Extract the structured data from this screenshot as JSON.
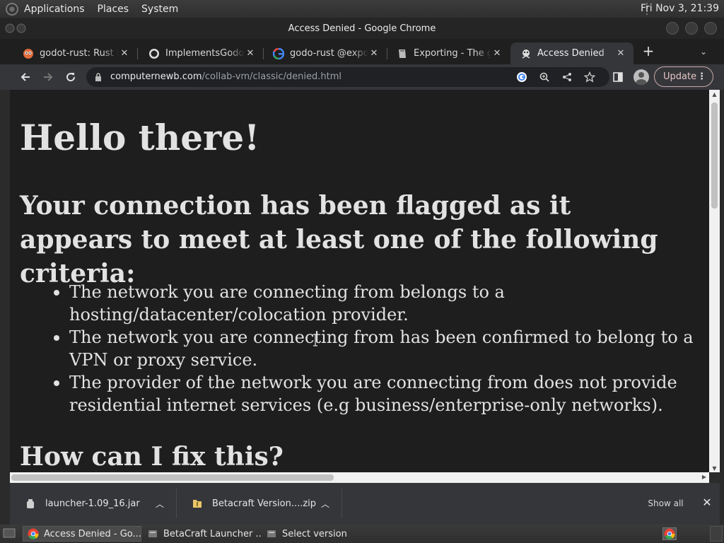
{
  "top_panel": {
    "menus": [
      "Applications",
      "Places",
      "System"
    ],
    "clock": "Fri Nov 3, 21:39"
  },
  "window": {
    "title": "Access Denied - Google Chrome"
  },
  "tabs": [
    {
      "title": "godot-rust: Rust bi",
      "icon": "owl-icon"
    },
    {
      "title": "ImplementsGodotE",
      "icon": "github-icon"
    },
    {
      "title": "godo-rust @export",
      "icon": "google-icon"
    },
    {
      "title": "Exporting - The gdr",
      "icon": "book-icon"
    },
    {
      "title": "Access Denied",
      "icon": "collabvm-icon"
    }
  ],
  "toolbar": {
    "url_host": "computernewb.com",
    "url_path": "/collab-vm/classic/denied.html",
    "update_label": "Update"
  },
  "page": {
    "heading": "Hello there!",
    "subheading": "Your connection has been flagged as it appears to meet at least one of the following criteria:",
    "criteria": [
      "The network you are connecting from belongs to a hosting/datacenter/colocation provider.",
      "The network you are connecting from has been confirmed to belong to a VPN or proxy service.",
      "The provider of the network you are connecting from does not provide residential internet services (e.g business/enterprise-only networks)."
    ],
    "fix_heading": "How can I fix this?"
  },
  "downloads": {
    "items": [
      "launcher-1.09_16.jar",
      "Betacraft Version....zip"
    ],
    "show_all_label": "Show all"
  },
  "taskbar": {
    "items": [
      "Access Denied - Go...",
      "BetaCraft Launcher ...",
      "Select version"
    ]
  }
}
